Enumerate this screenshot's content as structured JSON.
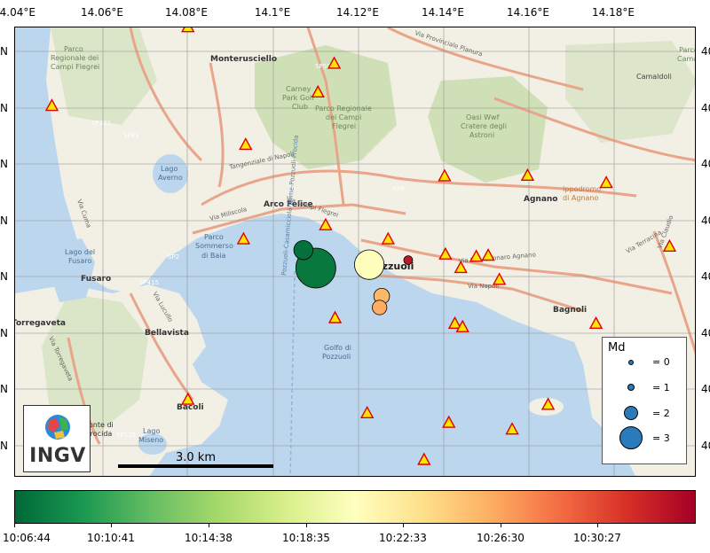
{
  "axes": {
    "top_ticks": [
      "14.04°E",
      "14.06°E",
      "14.08°E",
      "14.1°E",
      "14.12°E",
      "14.14°E",
      "14.16°E",
      "14.18°E"
    ],
    "left_ticks": [
      "N",
      "N",
      "N",
      "N",
      "N",
      "N",
      "N",
      "N"
    ],
    "right_ticks": [
      "40",
      "40",
      "40",
      "40",
      "40",
      "40",
      "40",
      "40"
    ]
  },
  "place_labels": [
    {
      "text": "Monterusciello"
    },
    {
      "text": "Parco"
    },
    {
      "text": "Regionale dei"
    },
    {
      "text": "Campi Flegrei"
    },
    {
      "text": "Carney"
    },
    {
      "text": "Park Golf"
    },
    {
      "text": "Club"
    },
    {
      "text": "Parco Regionale"
    },
    {
      "text": "dei Campi"
    },
    {
      "text": "Flegrei"
    },
    {
      "text": "Oasi Wwf"
    },
    {
      "text": "Cratere degli"
    },
    {
      "text": "Astroni"
    },
    {
      "text": "Camaldoli"
    },
    {
      "text": "Parco"
    },
    {
      "text": "Cama"
    },
    {
      "text": "Lago"
    },
    {
      "text": "Averno"
    },
    {
      "text": "Arco Felice"
    },
    {
      "text": "Agnano"
    },
    {
      "text": "Ippodromo"
    },
    {
      "text": "di Agnano"
    },
    {
      "text": "Parco"
    },
    {
      "text": "Sommerso"
    },
    {
      "text": "di Baia"
    },
    {
      "text": "Lago del"
    },
    {
      "text": "Fusaro"
    },
    {
      "text": "Fusaro"
    },
    {
      "text": "Pozzuoli"
    },
    {
      "text": "Bagnoli"
    },
    {
      "text": "Torregaveta"
    },
    {
      "text": "Bellavista"
    },
    {
      "text": "Golfo di"
    },
    {
      "text": "Pozzuoli"
    },
    {
      "text": "Bacoli"
    },
    {
      "text": "Monte di"
    },
    {
      "text": "Procida"
    },
    {
      "text": "Lago"
    },
    {
      "text": "Miseno"
    },
    {
      "text": "Via Campi Flegrei"
    },
    {
      "text": "Via Miliscola"
    },
    {
      "text": "Via Provinciale Pianura"
    },
    {
      "text": "Via San Gennaro Agnano"
    },
    {
      "text": "Via Napoli"
    },
    {
      "text": "Via Terracina"
    },
    {
      "text": "Via Claudio"
    },
    {
      "text": "Tangenziale di Napoli"
    },
    {
      "text": "A56"
    },
    {
      "text": "SP501"
    },
    {
      "text": "SP321"
    },
    {
      "text": "SP43"
    },
    {
      "text": "SP2"
    },
    {
      "text": "SP415"
    },
    {
      "text": "SP125"
    },
    {
      "text": "Pozzuoli-Casamicciola-Terme-Pozzuoli-Procida"
    },
    {
      "text": "Via Cuma"
    },
    {
      "text": "Via Lucullo"
    },
    {
      "text": "Via Torregaveta"
    }
  ],
  "stations": [
    {
      "lon": 14.0804,
      "lat": 40.8683
    },
    {
      "lon": 14.1146,
      "lat": 40.8618
    },
    {
      "lon": 14.0486,
      "lat": 40.8543
    },
    {
      "lon": 14.1108,
      "lat": 40.8567
    },
    {
      "lon": 14.0939,
      "lat": 40.8474
    },
    {
      "lon": 14.1404,
      "lat": 40.8418
    },
    {
      "lon": 14.1598,
      "lat": 40.8419
    },
    {
      "lon": 14.1782,
      "lat": 40.8406
    },
    {
      "lon": 14.1126,
      "lat": 40.8331
    },
    {
      "lon": 14.0934,
      "lat": 40.8306
    },
    {
      "lon": 14.1272,
      "lat": 40.8306
    },
    {
      "lon": 14.193,
      "lat": 40.8293
    },
    {
      "lon": 14.1406,
      "lat": 40.8279
    },
    {
      "lon": 14.1506,
      "lat": 40.8277
    },
    {
      "lon": 14.1478,
      "lat": 40.8275
    },
    {
      "lon": 14.1442,
      "lat": 40.8255
    },
    {
      "lon": 14.1532,
      "lat": 40.8234
    },
    {
      "lon": 14.1148,
      "lat": 40.8166
    },
    {
      "lon": 14.1428,
      "lat": 40.8156
    },
    {
      "lon": 14.1446,
      "lat": 40.815
    },
    {
      "lon": 14.1758,
      "lat": 40.8156
    },
    {
      "lon": 14.0804,
      "lat": 40.8021
    },
    {
      "lon": 14.1646,
      "lat": 40.8012
    },
    {
      "lon": 14.1223,
      "lat": 40.7997
    },
    {
      "lon": 14.1414,
      "lat": 40.798
    },
    {
      "lon": 14.1562,
      "lat": 40.7968
    },
    {
      "lon": 14.1356,
      "lat": 40.7914
    },
    {
      "lon": 14.1224,
      "lat": 40.7852
    },
    {
      "lon": 14.1602,
      "lat": 40.7852
    },
    {
      "lon": 14.062,
      "lat": 40.7831
    }
  ],
  "events": [
    {
      "lon": 14.1074,
      "lat": 40.8287,
      "md": 1.2,
      "time": "10:07:10"
    },
    {
      "lon": 14.1103,
      "lat": 40.8255,
      "md": 3.0,
      "time": "10:07:40"
    },
    {
      "lon": 14.1228,
      "lat": 40.8261,
      "md": 2.1,
      "time": "10:20:40"
    },
    {
      "lon": 14.1257,
      "lat": 40.8205,
      "md": 0.9,
      "time": "10:25:30"
    },
    {
      "lon": 14.1252,
      "lat": 40.8185,
      "md": 0.8,
      "time": "10:26:10"
    },
    {
      "lon": 14.1319,
      "lat": 40.8269,
      "md": 0.3,
      "time": "10:33:00"
    }
  ],
  "colorbar": {
    "label_ticks": [
      "10:06:44",
      "10:10:41",
      "10:14:38",
      "10:18:35",
      "10:22:33",
      "10:26:30",
      "10:30:27"
    ]
  },
  "legend": {
    "title": "Md",
    "items": [
      {
        "label": "= 0",
        "md": 0
      },
      {
        "label": "= 1",
        "md": 1
      },
      {
        "label": "= 2",
        "md": 2
      },
      {
        "label": "= 3",
        "md": 3
      }
    ]
  },
  "scalebar": {
    "label": "3.0 km"
  },
  "logo": {
    "text": "INGV"
  },
  "colors": {
    "sea": "#bcd6ee",
    "land": "#f2efe4",
    "green": "#c9dcae",
    "road": "#e8a58a",
    "station_fill": "#ffe600",
    "station_edge": "#e00000"
  }
}
